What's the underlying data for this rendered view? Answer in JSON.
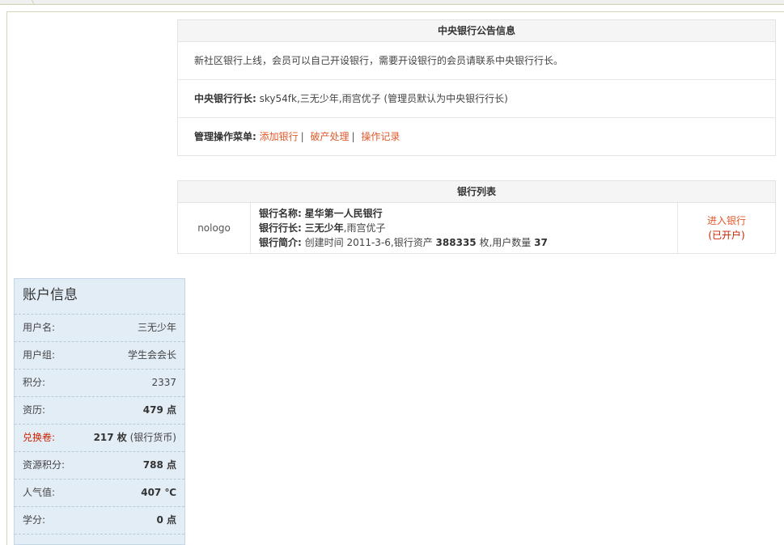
{
  "notice": {
    "title": "中央银行公告信息",
    "message": "新社区银行上线，会员可以自己开设银行，需要开设银行的会员请联系中央银行行长。",
    "governor_label": "中央银行行长:",
    "governor_value": " sky54fk,三无少年,雨宫优子 (管理员默认为中央银行行长)",
    "menu_label": "管理操作菜单:",
    "menu_items": [
      "添加银行",
      "破产处理",
      "操作记录"
    ]
  },
  "bank_list": {
    "title": "银行列表",
    "banks": [
      {
        "logo": "nologo",
        "name_label": "银行名称:",
        "name": "星华第一人民银行",
        "manager_label": "银行行长:",
        "manager_bold": "三无少年",
        "manager_rest": ",雨宫优子",
        "intro_label": "银行简介:",
        "intro_prefix": " 创建时间 2011-3-6,银行资产 ",
        "assets": "388335",
        "intro_mid": " 枚,用户数量 ",
        "users": "37",
        "enter_label": "进入银行",
        "status": "(已开户)"
      }
    ]
  },
  "account": {
    "title": "账户信息",
    "items": [
      {
        "label": "用户名:",
        "value": "三无少年",
        "unit": ""
      },
      {
        "label": "用户组:",
        "value": "学生会会长",
        "unit": ""
      },
      {
        "label": "积分:",
        "value": "2337",
        "unit": ""
      },
      {
        "label": "资历:",
        "value": "479",
        "unit": " 点"
      },
      {
        "label": "兑换卷:",
        "value": "217",
        "unit": " 枚",
        "note": " (银行货币)"
      },
      {
        "label": "资源积分:",
        "value": "788",
        "unit": " 点"
      },
      {
        "label": "人气值:",
        "value": "407",
        "unit": " ℃"
      },
      {
        "label": "学分:",
        "value": "0",
        "unit": " 点"
      }
    ]
  }
}
